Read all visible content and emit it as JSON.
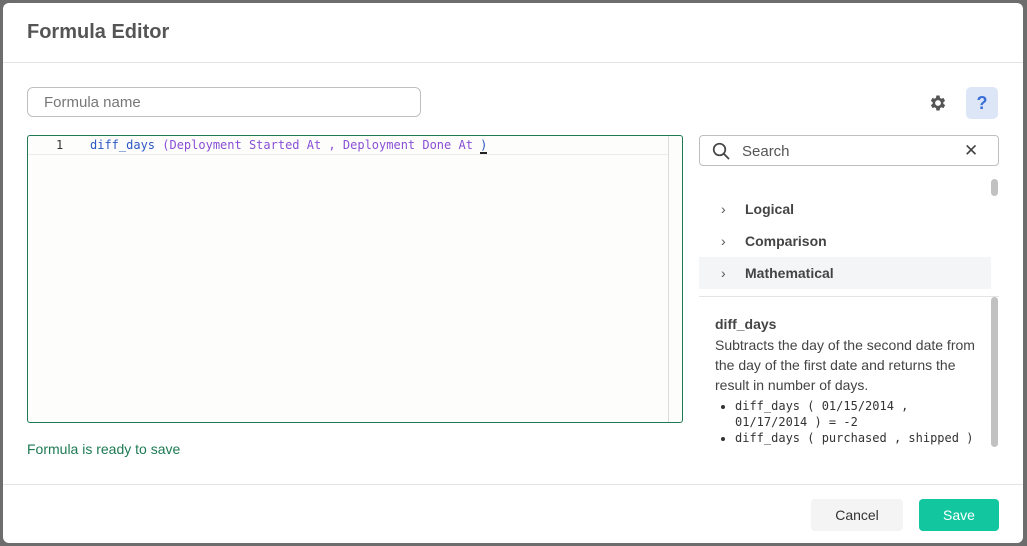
{
  "modal": {
    "title": "Formula Editor"
  },
  "formula_name": {
    "placeholder": "Formula name",
    "value": ""
  },
  "toolbar": {
    "settings_icon": "gear-icon",
    "help_label": "?"
  },
  "editor": {
    "line_number": "1",
    "function": "diff_days",
    "open_paren": " (",
    "arg1": "Deployment Started At",
    "comma": " , ",
    "arg2": "Deployment Done At",
    "close_paren": ")"
  },
  "status": {
    "text": "Formula is ready to save",
    "color": "#1d7a53"
  },
  "search": {
    "placeholder": "Search",
    "value": "",
    "clear_label": "✕"
  },
  "categories": [
    {
      "label": "Logical"
    },
    {
      "label": "Comparison"
    },
    {
      "label": "Mathematical"
    }
  ],
  "doc": {
    "title": "diff_days",
    "description": "Subtracts the day of the second date from the day of the first date and returns the result in number of days.",
    "examples": [
      "diff_days ( 01/15/2014 , 01/17/2014 ) = -2",
      "diff_days ( purchased , shipped )"
    ]
  },
  "footer": {
    "cancel_label": "Cancel",
    "save_label": "Save"
  },
  "colors": {
    "accent": "#12c7a0",
    "help_bg": "#dde6f7",
    "editor_border": "#1d7a53"
  }
}
